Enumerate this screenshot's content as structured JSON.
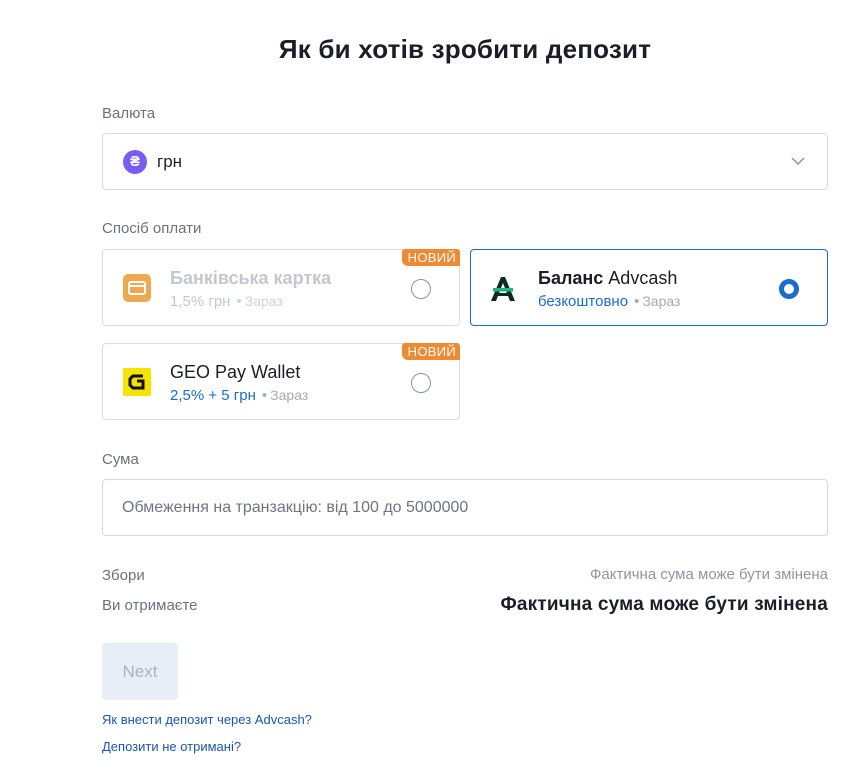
{
  "title": "Як би хотів зробити депозит",
  "currency": {
    "label": "Валюта",
    "icon_glyph": "₴",
    "icon": "hryvnia-icon",
    "value": "грн"
  },
  "payment": {
    "label": "Спосіб оплати",
    "methods": [
      {
        "name": "Банківська картка",
        "fee": "1,5% грн",
        "time": "Зараз",
        "badge": "НОВИЙ",
        "state": "disabled",
        "icon": "bank-card-icon"
      },
      {
        "name_bold": "Баланс",
        "name_rest": "Advcash",
        "fee": "безкоштовно",
        "time": "Зараз",
        "state": "selected",
        "icon": "advcash-logo-icon"
      },
      {
        "name": "GEO Pay Wallet",
        "fee": "2,5% + 5 грн",
        "time": "Зараз",
        "badge": "НОВИЙ",
        "state": "default",
        "icon": "geo-pay-logo-icon"
      }
    ]
  },
  "amount": {
    "label": "Сума",
    "placeholder": "Обмеження на транзакцію: від 100 до 5000000"
  },
  "fees": {
    "label": "Збори",
    "value": "Фактична сума може бути змінена"
  },
  "receive": {
    "label": "Ви отримаєте",
    "value": "Фактична сума може бути змінена"
  },
  "next_label": "Next",
  "links": [
    "Як внести депозит через Advcash?",
    "Депозити не отримані?"
  ],
  "colors": {
    "accent": "#1a6dcc",
    "badge": "#f08a31",
    "currency_icon": "#7a5cf4",
    "geo_logo": "#f5e400",
    "bank_card": "#f0a850"
  }
}
